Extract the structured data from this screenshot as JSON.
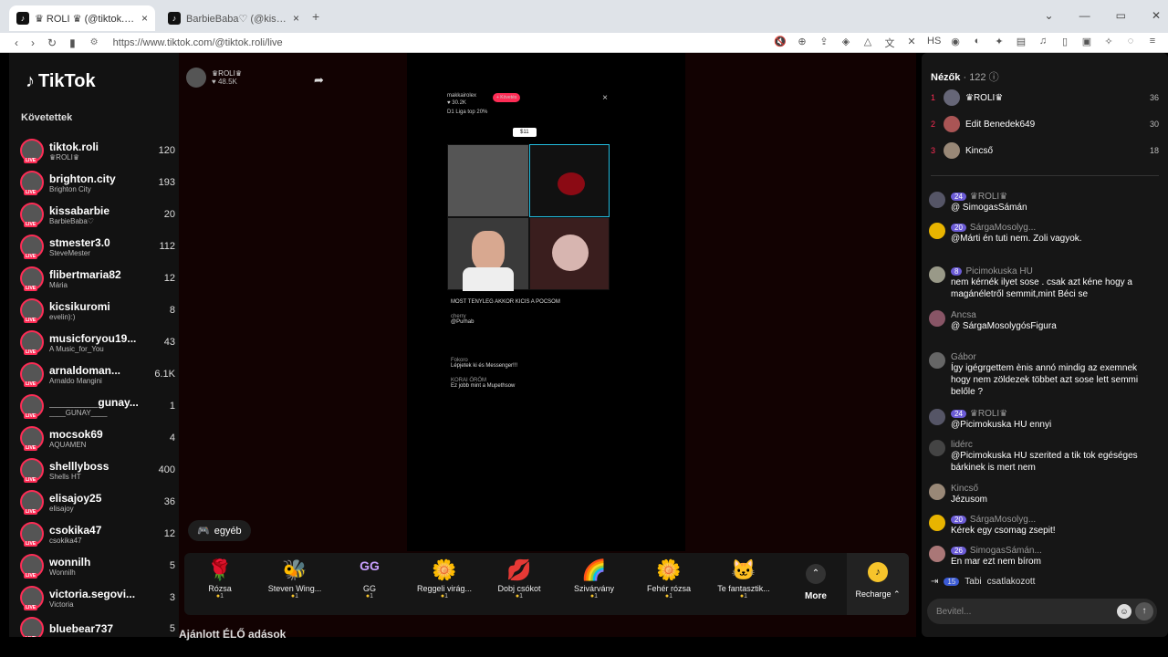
{
  "browser": {
    "tabs": [
      {
        "title": "♛ ROLI ♛ (@tiktok.roli)",
        "active": true
      },
      {
        "title": "BarbieBaba♡ (@kissabarbie) ÉLŐ",
        "active": false
      }
    ],
    "url": "https://www.tiktok.com/@tiktok.roli/live"
  },
  "sidebar": {
    "logo": "TikTok",
    "heading": "Követettek",
    "accounts": [
      {
        "name": "tiktok.roli",
        "sub": "♛ROLI♛",
        "count": "120"
      },
      {
        "name": "brighton.city",
        "sub": "Brighton City",
        "count": "193"
      },
      {
        "name": "kissabarbie",
        "sub": "BarbieBaba♡",
        "count": "20"
      },
      {
        "name": "stmester3.0",
        "sub": "SteveMester",
        "count": "112"
      },
      {
        "name": "flibertmaria82",
        "sub": "Mária",
        "count": "12"
      },
      {
        "name": "kicsikuromi",
        "sub": "evelin):)",
        "count": "8"
      },
      {
        "name": "musicforyou19...",
        "sub": "A Music_for_You",
        "count": "43"
      },
      {
        "name": "arnaldoman...",
        "sub": "Arnaldo Mangini",
        "count": "6.1K"
      },
      {
        "name": "________gunay...",
        "sub": "____GUNAY____",
        "count": "1"
      },
      {
        "name": "mocsok69",
        "sub": "AQUAMEN",
        "count": "4"
      },
      {
        "name": "shelllyboss",
        "sub": "Shells HT",
        "count": "400"
      },
      {
        "name": "elisajoy25",
        "sub": "elisajoy",
        "count": "36"
      },
      {
        "name": "csokika47",
        "sub": "csokika47",
        "count": "12"
      },
      {
        "name": "wonnilh",
        "sub": "Wonnilh",
        "count": "5"
      },
      {
        "name": "victoria.segovi...",
        "sub": "Victoria",
        "count": "3"
      },
      {
        "name": "bluebear737",
        "sub": "",
        "count": "5"
      }
    ]
  },
  "stream": {
    "host_name": "♛ROLI♛",
    "likes": "♥ 48.5K",
    "video": {
      "host": "makkairolex",
      "host_likes": "♥ 30.2K",
      "follow_label": "+ Követés",
      "league": "D1 Liga top 20%",
      "price": "$11",
      "chat": [
        {
          "user": "",
          "text": "MOST TENYLEG AKKOR KICIS A POCSOM"
        },
        {
          "user": "cherry",
          "text": "@Purhab"
        },
        {
          "user": "",
          "text": ""
        },
        {
          "user": "Fokoro",
          "text": "Lépjetek ki és Messenger!!!"
        },
        {
          "user": "KORAI ÖRÖM",
          "text": "Ez jobb mint a Mupethsow"
        }
      ]
    },
    "category": "egyéb",
    "gifts": [
      {
        "name": "Rózsa",
        "cost": "1",
        "icon": "🌹"
      },
      {
        "name": "Steven Wing...",
        "cost": "1",
        "icon": "🐝"
      },
      {
        "name": "GG",
        "cost": "1",
        "icon": "GG"
      },
      {
        "name": "Reggeli virág...",
        "cost": "1",
        "icon": "🌼"
      },
      {
        "name": "Dobj csókot",
        "cost": "1",
        "icon": "💋"
      },
      {
        "name": "Szivárvány",
        "cost": "1",
        "icon": "🌈"
      },
      {
        "name": "Fehér rózsa",
        "cost": "1",
        "icon": "🌼"
      },
      {
        "name": "Te fantasztik...",
        "cost": "1",
        "icon": "🐱"
      }
    ],
    "more_label": "More",
    "recharge_label": "Recharge ⌃",
    "recommended": "Ajánlott ÉLŐ adások"
  },
  "panel": {
    "viewers_label": "Nézők",
    "viewers_count": "· 122",
    "top": [
      {
        "rank": "1",
        "name": "♛ROLI♛",
        "points": "36"
      },
      {
        "rank": "2",
        "name": "Edit Benedek649",
        "points": "30"
      },
      {
        "rank": "3",
        "name": "Kincső",
        "points": "18"
      }
    ],
    "messages": [
      {
        "level": "24",
        "user": "♛ROLI♛",
        "text": "@ SimogasSámán"
      },
      {
        "level": "20",
        "user": "SárgaMosolyg...",
        "text": "@Márti  én tuti nem. Zoli vagyok."
      },
      {
        "level": "8",
        "user": "Picimokuska HU",
        "text": "nem kérnék ilyet sose . csak azt kéne hogy a magánéletről semmit,mint Béci se"
      },
      {
        "level": "",
        "user": "Ancsa",
        "text": "@ SárgaMosolygósFigura"
      },
      {
        "level": "",
        "user": "Gábor",
        "text": "Így igégrgettem ènis annó mindig az exemnek hogy nem zöldezek többet azt sose lett semmi belőle ?"
      },
      {
        "level": "24",
        "user": "♛ROLI♛",
        "text": "@Picimokuska HU ennyi"
      },
      {
        "level": "",
        "user": "lidérc",
        "text": "@Picimokuska HU szerited a tik tok egéséges bárkinek is mert nem"
      },
      {
        "level": "",
        "user": "Kincső",
        "text": "Jézusom"
      },
      {
        "level": "20",
        "user": "SárgaMosolyg...",
        "text": "Kérek egy csomag zsepit!"
      },
      {
        "level": "26",
        "user": "SimogasSámán...",
        "text": "En mar ezt nem bírom"
      }
    ],
    "joined_level": "15",
    "joined_user": "Tabi",
    "joined_text": "csatlakozott",
    "input_placeholder": "Bevitel..."
  }
}
